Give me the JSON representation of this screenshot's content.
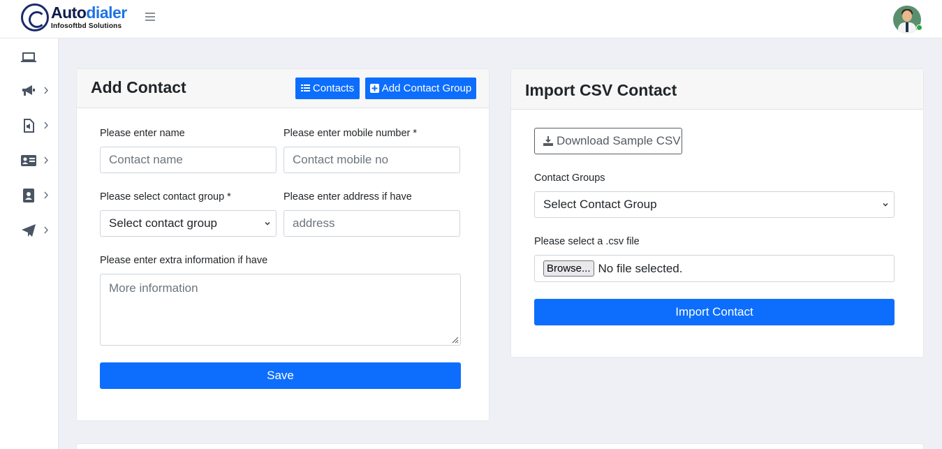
{
  "brand": {
    "name_prefix": "Auto",
    "name_suffix": "dialer",
    "tagline": "Infosoftbd Solutions"
  },
  "sidebar": {
    "items": [
      {
        "icon": "laptop-icon",
        "has_submenu": false
      },
      {
        "icon": "megaphone-icon",
        "has_submenu": true
      },
      {
        "icon": "audio-file-icon",
        "has_submenu": true
      },
      {
        "icon": "id-card-icon",
        "has_submenu": true
      },
      {
        "icon": "address-book-icon",
        "has_submenu": true
      },
      {
        "icon": "paper-plane-icon",
        "has_submenu": true
      }
    ]
  },
  "add_contact": {
    "title": "Add Contact",
    "contacts_button": "Contacts",
    "add_group_button": "Add Contact Group",
    "name_label": "Please enter name",
    "name_placeholder": "Contact name",
    "mobile_label": "Please enter mobile number *",
    "mobile_placeholder": "Contact mobile no",
    "group_label": "Please select contact group *",
    "group_selected": "Select contact group",
    "address_label": "Please enter address if have",
    "address_placeholder": "address",
    "extra_label": "Please enter extra information if have",
    "extra_placeholder": "More information",
    "save_button": "Save"
  },
  "import_csv": {
    "title": "Import CSV Contact",
    "download_button": "Download Sample CSV",
    "groups_label": "Contact Groups",
    "groups_selected": "Select Contact Group",
    "file_label": "Please select a .csv file",
    "browse_button": "Browse...",
    "file_status": "No file selected.",
    "import_button": "Import Contact"
  },
  "colors": {
    "primary": "#0d6efd",
    "background": "#eef0f5",
    "online": "#28a745"
  }
}
